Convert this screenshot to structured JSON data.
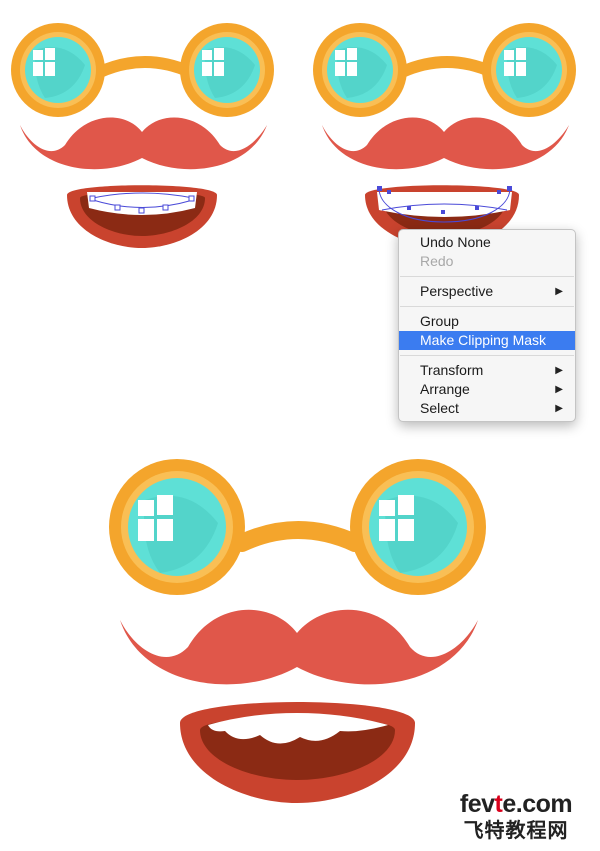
{
  "context_menu": {
    "items": [
      {
        "label": "Undo None",
        "enabled": true
      },
      {
        "label": "Redo",
        "enabled": false
      },
      {
        "label": "Perspective",
        "submenu": true
      },
      {
        "label": "Group"
      },
      {
        "label": "Make Clipping Mask",
        "highlighted": true
      },
      {
        "label": "Transform",
        "submenu": true
      },
      {
        "label": "Arrange",
        "submenu": true
      },
      {
        "label": "Select",
        "submenu": true
      }
    ],
    "highlight_color": "#3b7cf0"
  },
  "colors": {
    "glasses_frame": "#f4a52c",
    "lens": "#5ee0d6",
    "mustache": "#e0574a",
    "lips": "#c9432e",
    "mouth_inner": "#8b2a14",
    "teeth": "#ffffff",
    "selection": "#4a4ad8"
  },
  "watermark": {
    "brand_prefix": "fev",
    "brand_e": "t",
    "brand_suffix": "e.com",
    "subtitle": "飞特教程网"
  }
}
